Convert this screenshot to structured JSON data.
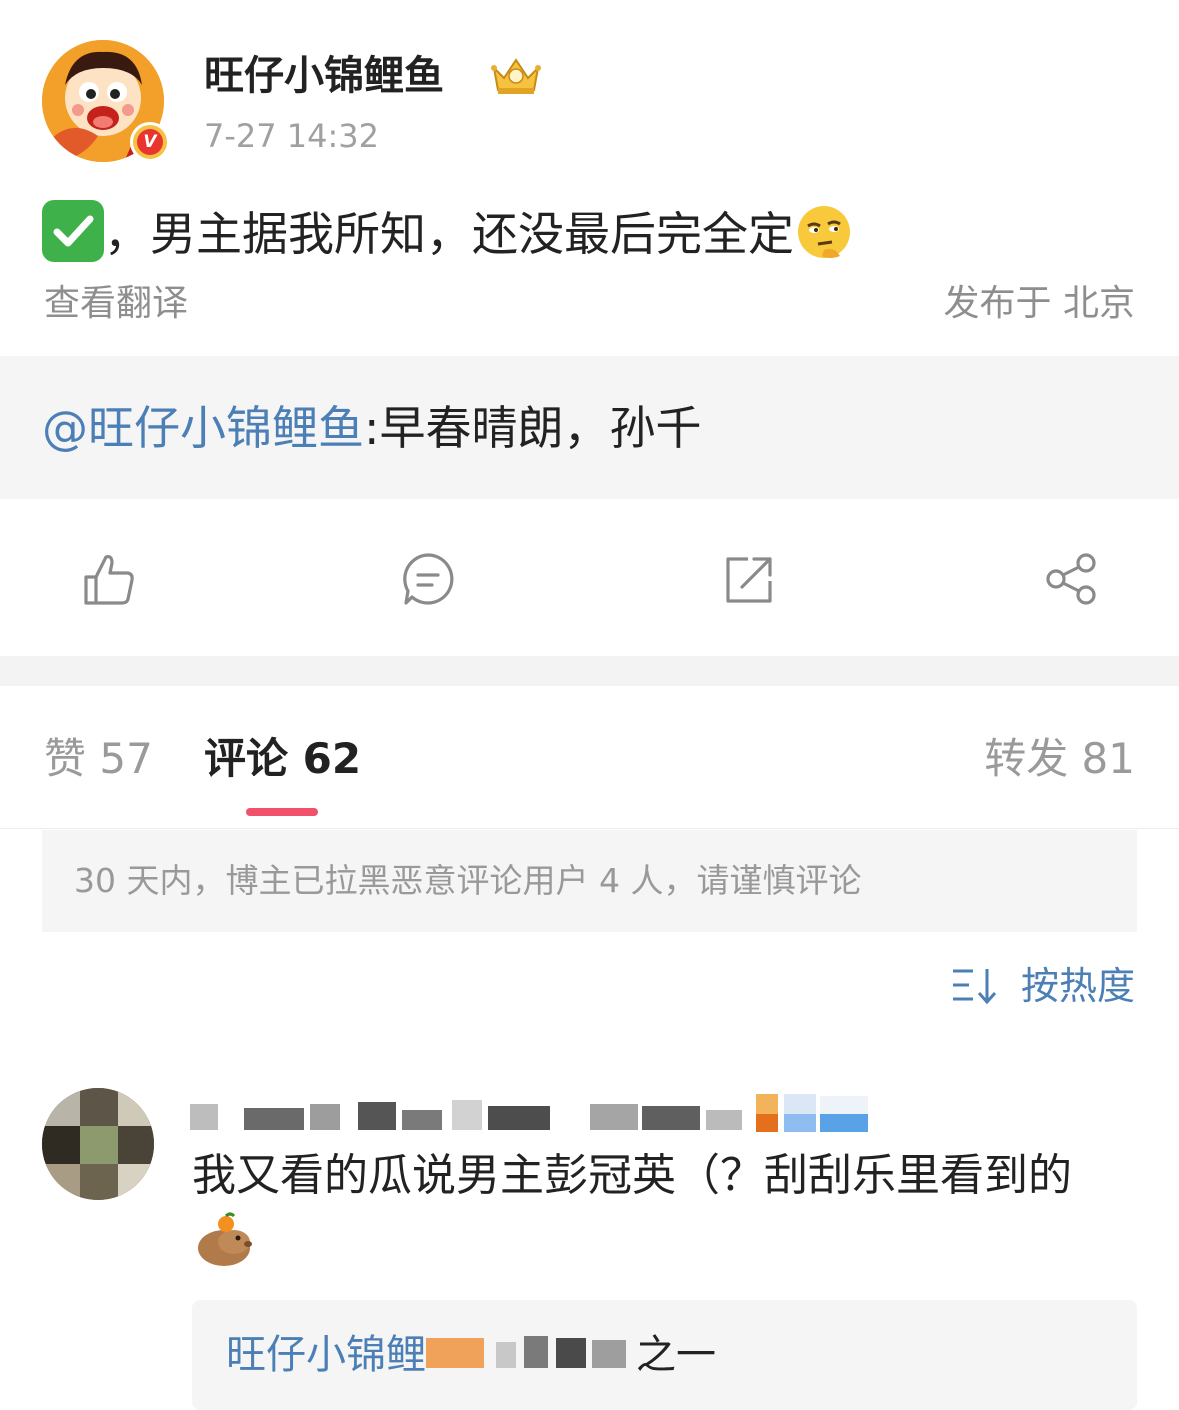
{
  "post": {
    "author_name": "旺仔小锦鲤鱼",
    "time": "7-27 14:32",
    "text_after_check": "，男主据我所知，还没最后完全定",
    "translate_label": "查看翻译",
    "location": "发布于 北京",
    "check_icon": "check-mark-button-emoji",
    "face_icon": "thinking-eye-roll-emoji"
  },
  "repost": {
    "author": "@旺仔小锦鲤鱼",
    "text": ":早春晴朗，孙千"
  },
  "actions": {
    "like_icon": "thumbs-up-icon",
    "comment_icon": "comment-icon",
    "repost_icon": "repost-icon",
    "share_icon": "share-icon"
  },
  "tabs": {
    "likes": "赞 57",
    "comments": "评论 62",
    "reposts": "转发 81"
  },
  "notice": "30 天内，博主已拉黑恶意评论用户 4 人，请谨慎评论",
  "sort": {
    "label": "按热度",
    "icon": "sort-icon"
  },
  "comment": {
    "text_line": "我又看的瓜说男主彭冠英（？刮刮乐里看到的",
    "reply_author": "旺仔小锦鲤",
    "reply_suffix": "之一"
  },
  "colors": {
    "link_blue": "#4b7fb6",
    "tab_underline": "#f2516b",
    "muted_gray": "#9a9a9a",
    "panel_bg": "#f5f5f5"
  }
}
